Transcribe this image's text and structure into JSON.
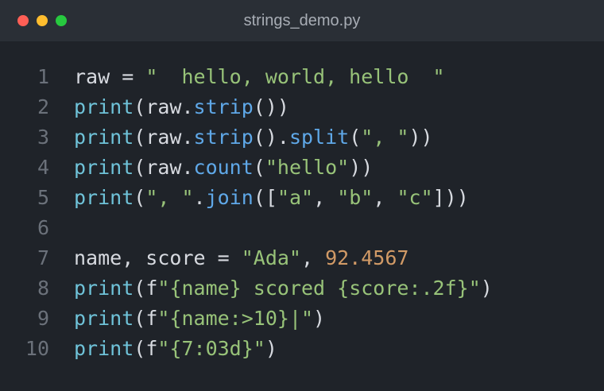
{
  "window": {
    "title": "strings_demo.py",
    "controls": {
      "close_color": "#ff5f56",
      "minimize_color": "#ffbd2e",
      "maximize_color": "#27c93f"
    }
  },
  "theme": {
    "function": "#6fc3d9",
    "method": "#5fa8e8",
    "string": "#98c379",
    "number": "#d19a66",
    "text": "#d7dae0",
    "line_number": "#6b717a"
  },
  "editor": {
    "lines": [
      {
        "number": "1",
        "tokens": [
          {
            "type": "txt",
            "text": "raw = "
          },
          {
            "type": "str",
            "text": "\"  hello, world, hello  \""
          }
        ]
      },
      {
        "number": "2",
        "tokens": [
          {
            "type": "fn",
            "text": "print"
          },
          {
            "type": "txt",
            "text": "(raw."
          },
          {
            "type": "meth",
            "text": "strip"
          },
          {
            "type": "txt",
            "text": "())"
          }
        ]
      },
      {
        "number": "3",
        "tokens": [
          {
            "type": "fn",
            "text": "print"
          },
          {
            "type": "txt",
            "text": "(raw."
          },
          {
            "type": "meth",
            "text": "strip"
          },
          {
            "type": "txt",
            "text": "()."
          },
          {
            "type": "meth",
            "text": "split"
          },
          {
            "type": "txt",
            "text": "("
          },
          {
            "type": "str",
            "text": "\", \""
          },
          {
            "type": "txt",
            "text": "))"
          }
        ]
      },
      {
        "number": "4",
        "tokens": [
          {
            "type": "fn",
            "text": "print"
          },
          {
            "type": "txt",
            "text": "(raw."
          },
          {
            "type": "meth",
            "text": "count"
          },
          {
            "type": "txt",
            "text": "("
          },
          {
            "type": "str",
            "text": "\"hello\""
          },
          {
            "type": "txt",
            "text": "))"
          }
        ]
      },
      {
        "number": "5",
        "tokens": [
          {
            "type": "fn",
            "text": "print"
          },
          {
            "type": "txt",
            "text": "("
          },
          {
            "type": "str",
            "text": "\", \""
          },
          {
            "type": "txt",
            "text": "."
          },
          {
            "type": "meth",
            "text": "join"
          },
          {
            "type": "txt",
            "text": "(["
          },
          {
            "type": "str",
            "text": "\"a\""
          },
          {
            "type": "txt",
            "text": ", "
          },
          {
            "type": "str",
            "text": "\"b\""
          },
          {
            "type": "txt",
            "text": ", "
          },
          {
            "type": "str",
            "text": "\"c\""
          },
          {
            "type": "txt",
            "text": "]))"
          }
        ]
      },
      {
        "number": "6",
        "tokens": []
      },
      {
        "number": "7",
        "tokens": [
          {
            "type": "txt",
            "text": "name, score = "
          },
          {
            "type": "str",
            "text": "\"Ada\""
          },
          {
            "type": "txt",
            "text": ", "
          },
          {
            "type": "num",
            "text": "92.4567"
          }
        ]
      },
      {
        "number": "8",
        "tokens": [
          {
            "type": "fn",
            "text": "print"
          },
          {
            "type": "txt",
            "text": "(f"
          },
          {
            "type": "str",
            "text": "\"{name} scored {score:.2f}\""
          },
          {
            "type": "txt",
            "text": ")"
          }
        ]
      },
      {
        "number": "9",
        "tokens": [
          {
            "type": "fn",
            "text": "print"
          },
          {
            "type": "txt",
            "text": "(f"
          },
          {
            "type": "str",
            "text": "\"{name:>10}|\""
          },
          {
            "type": "txt",
            "text": ")"
          }
        ]
      },
      {
        "number": "10",
        "tokens": [
          {
            "type": "fn",
            "text": "print"
          },
          {
            "type": "txt",
            "text": "(f"
          },
          {
            "type": "str",
            "text": "\"{7:03d}\""
          },
          {
            "type": "txt",
            "text": ")"
          }
        ]
      }
    ]
  }
}
